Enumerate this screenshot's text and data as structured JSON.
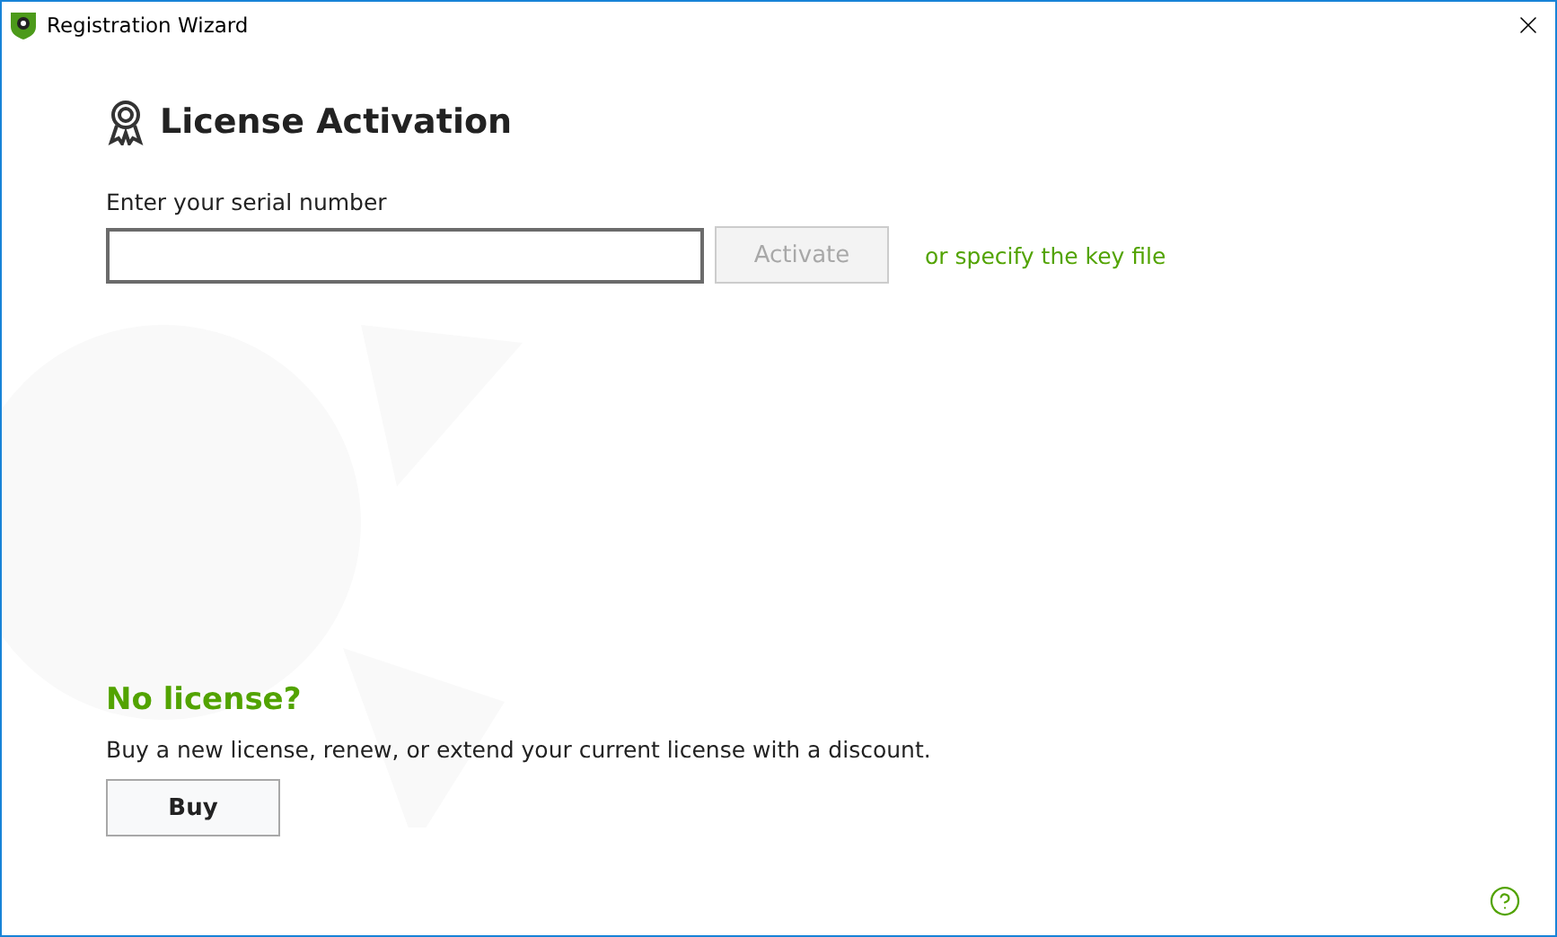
{
  "window": {
    "title": "Registration Wizard"
  },
  "heading": "License Activation",
  "serial": {
    "label": "Enter your serial number"
  },
  "activate_button": {
    "label": "Activate",
    "disabled": true
  },
  "key_file_link": "or specify the key file",
  "no_license": {
    "title": "No license?",
    "description": "Buy a new license, renew, or extend your current license with a discount.",
    "button": "Buy"
  }
}
